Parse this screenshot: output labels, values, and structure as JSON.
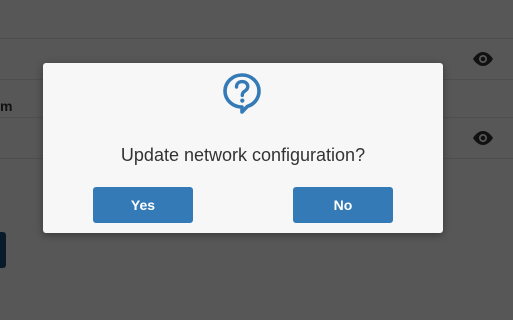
{
  "background": {
    "partial_label": "m",
    "row_icon": "eye-icon"
  },
  "dialog": {
    "icon": "question-bubble-icon",
    "message": "Update network configuration?",
    "yes_label": "Yes",
    "no_label": "No",
    "accent_color": "#337ab7"
  }
}
